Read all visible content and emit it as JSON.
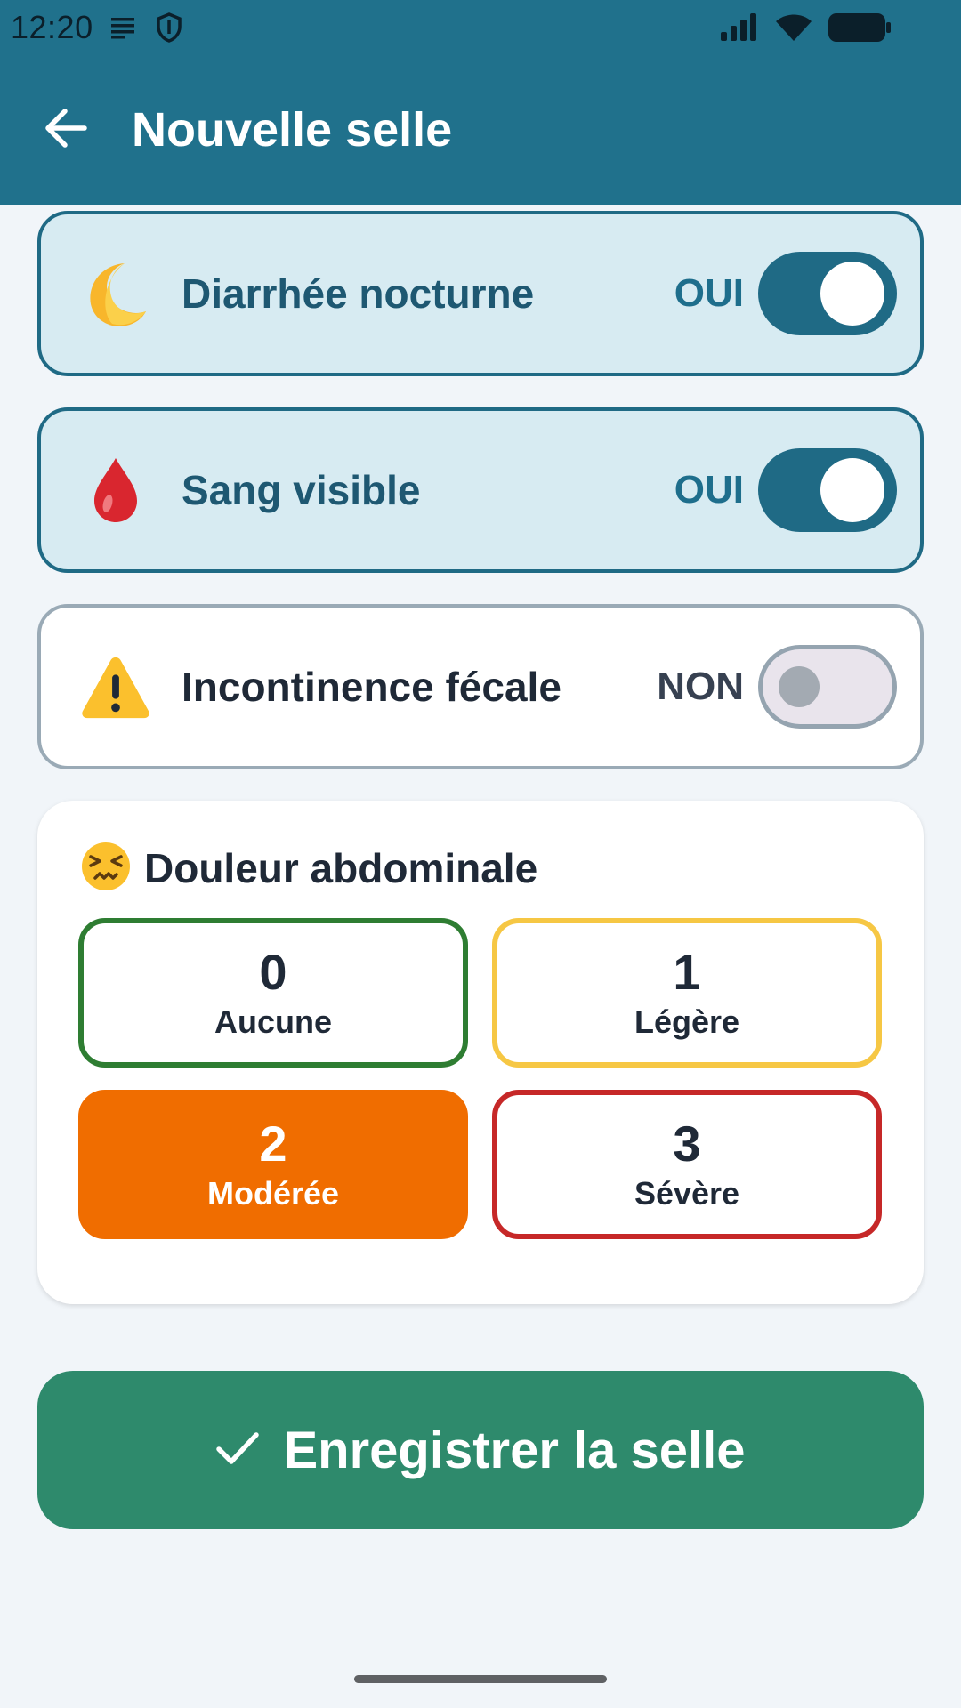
{
  "status_bar": {
    "time": "12:20",
    "icons": [
      "notes-icon",
      "shield-icon",
      "signal-icon",
      "wifi-icon",
      "battery-icon"
    ]
  },
  "app_bar": {
    "title": "Nouvelle selle",
    "back_icon": "arrow-left-icon"
  },
  "toggles": [
    {
      "icon": "crescent-moon-icon",
      "label": "Diarrhée nocturne",
      "state_label": "OUI",
      "on": true
    },
    {
      "icon": "blood-drop-icon",
      "label": "Sang visible",
      "state_label": "OUI",
      "on": true
    },
    {
      "icon": "warning-icon",
      "label": "Incontinence fécale",
      "state_label": "NON",
      "on": false
    }
  ],
  "pain": {
    "icon": "persevering-face-icon",
    "title": "Douleur abdominale",
    "options": [
      {
        "value": "0",
        "label": "Aucune",
        "color": "#2e7d32",
        "selected": false
      },
      {
        "value": "1",
        "label": "Légère",
        "color": "#f6c744",
        "selected": false
      },
      {
        "value": "2",
        "label": "Modérée",
        "color": "#f06d00",
        "selected": true
      },
      {
        "value": "3",
        "label": "Sévère",
        "color": "#c62828",
        "selected": false
      }
    ]
  },
  "save_button": {
    "icon": "checkmark-icon",
    "label": "Enregistrer la selle"
  },
  "colors": {
    "primary": "#20718c",
    "save": "#2e8a6c",
    "background": "#f1f5f9"
  }
}
